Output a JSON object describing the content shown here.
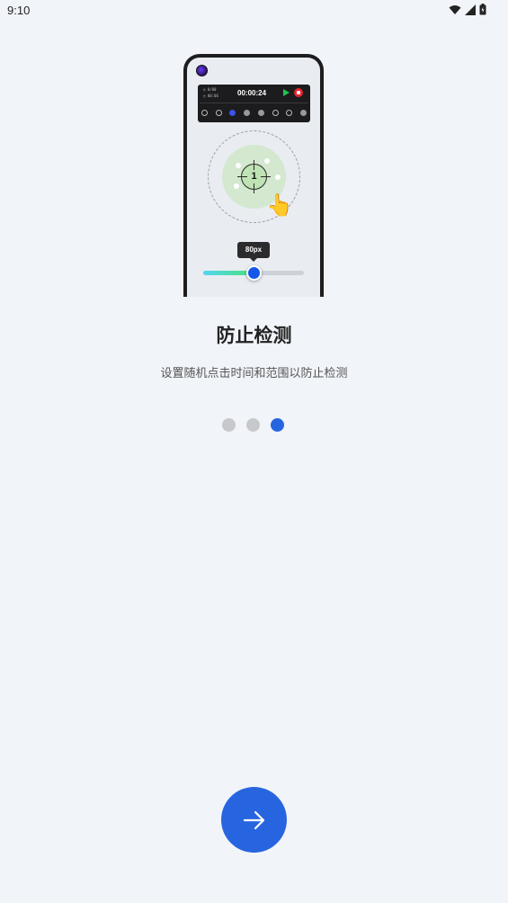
{
  "status_bar": {
    "time": "9:10",
    "icons": [
      "wifi-icon",
      "signal-icon",
      "battery-icon"
    ]
  },
  "illustration": {
    "panel": {
      "stat_line_1": "◷ 0/00",
      "stat_line_2": "◷ 00:06",
      "timer": "00:00:24",
      "icons": [
        "power-icon",
        "eye-icon",
        "target-icon",
        "minus-circle-icon",
        "minus-circle-icon",
        "swipe-icon",
        "save-icon",
        "settings-icon"
      ]
    },
    "click_point_number": "1",
    "slider": {
      "tooltip": "80px",
      "value_fraction": 0.5
    }
  },
  "onboarding": {
    "title": "防止检测",
    "description": "设置随机点击时间和范围以防止检测",
    "page_count": 3,
    "current_page": 3
  },
  "colors": {
    "accent": "#2765e0",
    "background": "#f1f4f9",
    "dot_inactive": "#c6c8cc"
  },
  "next_button": {
    "icon": "arrow-right-icon"
  }
}
